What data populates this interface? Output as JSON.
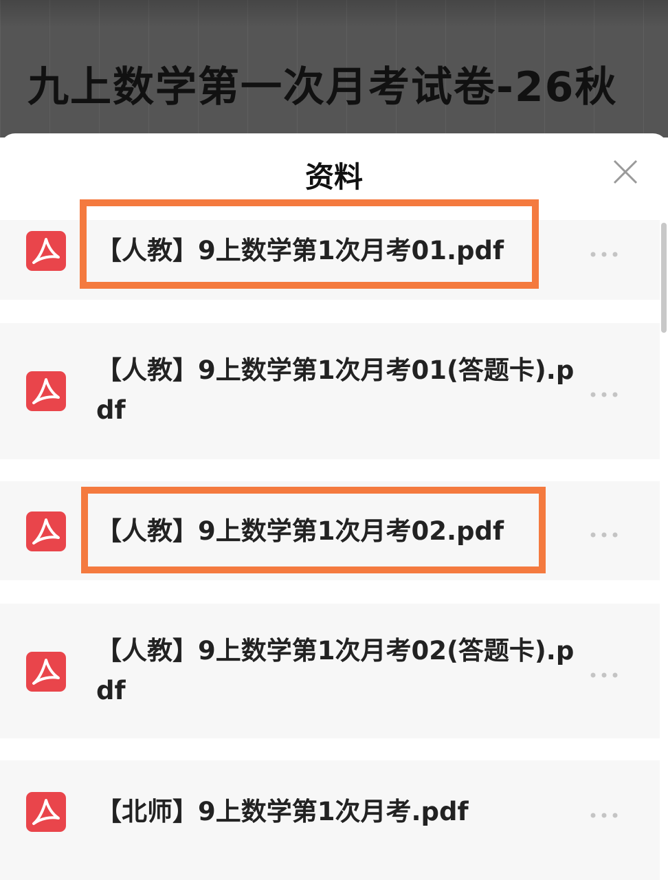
{
  "page": {
    "title": "九上数学第一次月考试卷-26秋"
  },
  "sheet": {
    "title": "资料",
    "close_icon": "close-icon",
    "file_icon": "pdf-icon",
    "more_icon": "more-dots-icon",
    "files": [
      {
        "name": "【人教】9上数学第1次月考01.pdf",
        "highlighted": true
      },
      {
        "name": "【人教】9上数学第1次月考01(答题卡).pdf",
        "highlighted": false
      },
      {
        "name": "【人教】9上数学第1次月考02.pdf",
        "highlighted": true
      },
      {
        "name": "【人教】9上数学第1次月考02(答题卡).pdf",
        "highlighted": false
      },
      {
        "name": "【北师】9上数学第1次月考.pdf",
        "highlighted": false
      }
    ]
  },
  "colors": {
    "highlight": "#f47a3f",
    "pdf_icon": "#e9454b",
    "backdrop": "#555555",
    "row_background": "#f7f7f7"
  }
}
